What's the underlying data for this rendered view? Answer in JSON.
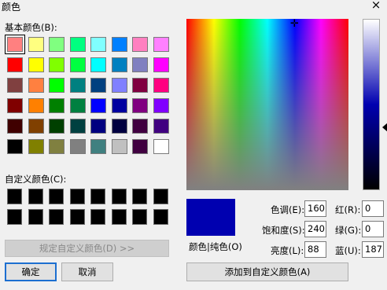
{
  "window": {
    "title": "颜色",
    "close_glyph": "×"
  },
  "basic": {
    "label": "基本颜色(B):",
    "colors": [
      [
        "#ff8080",
        "#ffff80",
        "#80ff80",
        "#00ff80",
        "#80ffff",
        "#0080ff",
        "#ff80c0",
        "#ff80ff"
      ],
      [
        "#ff0000",
        "#ffff00",
        "#80ff00",
        "#00ff40",
        "#00ffff",
        "#0080c0",
        "#8080c0",
        "#ff00ff"
      ],
      [
        "#804040",
        "#ff8040",
        "#00ff00",
        "#008080",
        "#004080",
        "#8080ff",
        "#800040",
        "#ff0080"
      ],
      [
        "#800000",
        "#ff8000",
        "#008000",
        "#008040",
        "#0000ff",
        "#0000a0",
        "#800080",
        "#8000ff"
      ],
      [
        "#400000",
        "#804000",
        "#004000",
        "#004040",
        "#000080",
        "#000040",
        "#400040",
        "#400080"
      ],
      [
        "#000000",
        "#808000",
        "#808040",
        "#808080",
        "#408080",
        "#c0c0c0",
        "#400040",
        "#ffffff"
      ]
    ]
  },
  "custom": {
    "label": "自定义颜色(C):"
  },
  "define_button": "规定自定义颜色(D) >>",
  "ok_button": "确定",
  "cancel_button": "取消",
  "preview": {
    "label": "颜色|纯色(O)",
    "color": "#0000b0"
  },
  "fields": {
    "hue": {
      "label": "色调(E):",
      "value": "160"
    },
    "sat": {
      "label": "饱和度(S):",
      "value": "240"
    },
    "lum": {
      "label": "亮度(L):",
      "value": "88"
    },
    "red": {
      "label": "红(R):",
      "value": "0"
    },
    "green": {
      "label": "绿(G):",
      "value": "0"
    },
    "blue": {
      "label": "蓝(U):",
      "value": "187"
    }
  },
  "add_button": "添加到自定义颜色(A)"
}
